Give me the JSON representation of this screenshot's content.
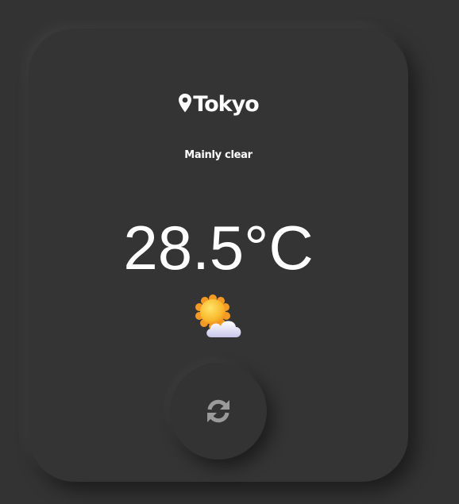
{
  "location": {
    "city": "Tokyo",
    "icon": "map-pin-icon"
  },
  "weather": {
    "condition": "Mainly clear",
    "temperature": "28.5",
    "unit": "°C",
    "icon": "sun-behind-cloud-icon"
  },
  "actions": {
    "refresh_icon": "refresh-icon"
  },
  "colors": {
    "background": "#333333",
    "card": "#343434",
    "text": "#ffffff",
    "refresh_icon": "#9a9a9a",
    "sun": "#f7b92c",
    "cloud": "#e6e6f5"
  }
}
